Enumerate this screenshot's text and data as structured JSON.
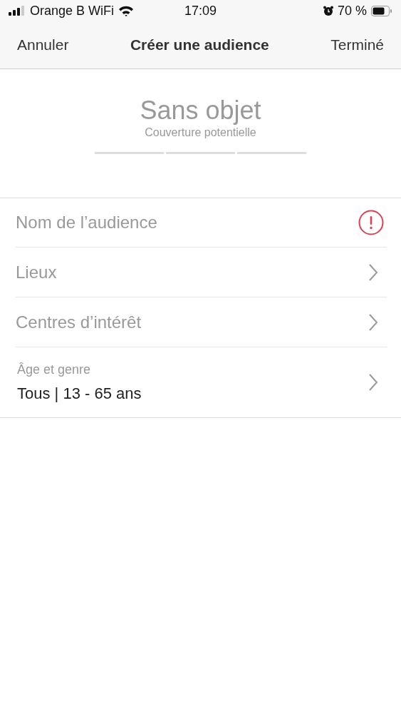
{
  "status_bar": {
    "carrier": "Orange B WiFi",
    "time": "17:09",
    "battery": "70 %"
  },
  "nav": {
    "cancel": "Annuler",
    "title": "Créer une audience",
    "done": "Terminé"
  },
  "summary": {
    "reach": "Sans objet",
    "caption": "Couverture potentielle"
  },
  "rows": [
    {
      "kind": "field",
      "placeholder": "Nom de l’audience",
      "error": true
    },
    {
      "kind": "link",
      "label": "Lieux"
    },
    {
      "kind": "link",
      "label": "Centres d’intérêt"
    },
    {
      "kind": "detail",
      "label": "Âge et genre",
      "value": "Tous | 13 - 65 ans"
    }
  ]
}
